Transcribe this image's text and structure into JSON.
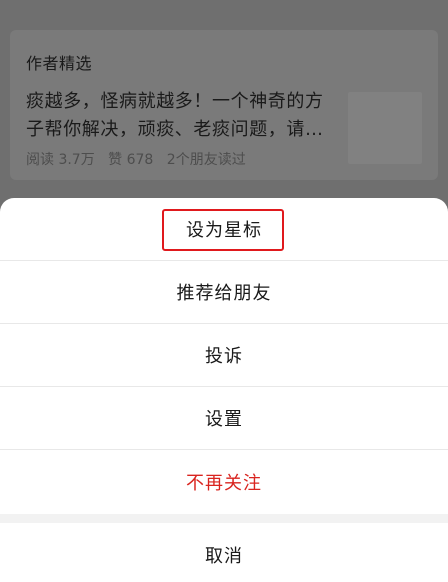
{
  "card": {
    "header": "作者精选",
    "article_title": "痰越多，怪病就越多！一个神奇的方子帮你解决，顽痰、老痰问题，请…",
    "reads": "阅读 3.7万",
    "likes": "赞 678",
    "friends": "2个朋友读过"
  },
  "sheet": {
    "items": [
      {
        "label": "设为星标"
      },
      {
        "label": "推荐给朋友"
      },
      {
        "label": "投诉"
      },
      {
        "label": "设置"
      },
      {
        "label": "不再关注"
      }
    ],
    "cancel_label": "取消",
    "highlight_color": "#e0191d",
    "danger_color": "#d9241f"
  }
}
